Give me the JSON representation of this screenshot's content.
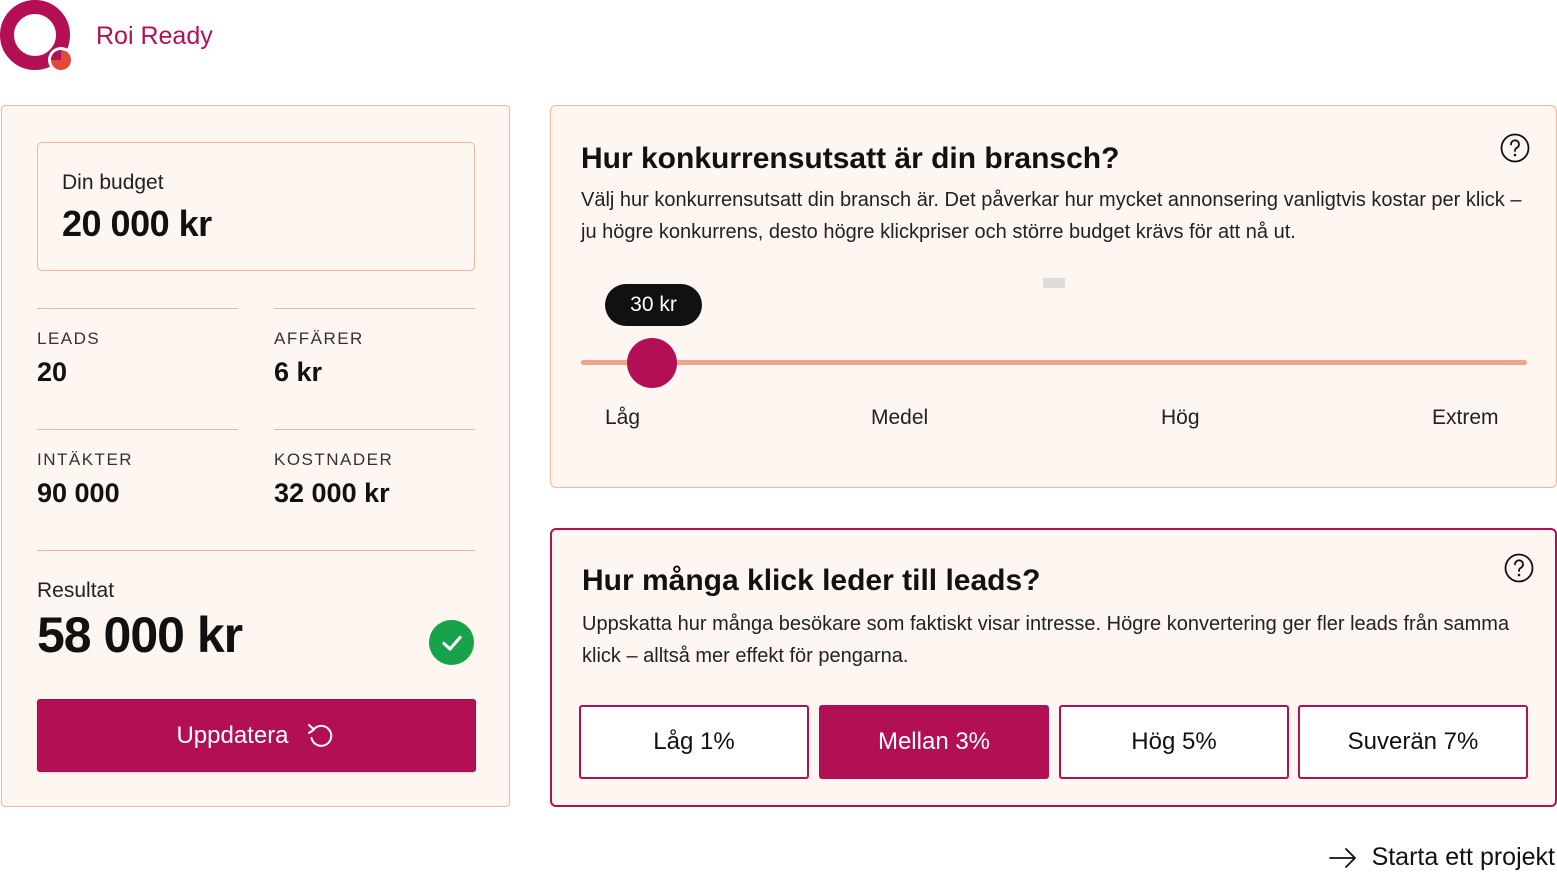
{
  "brand": {
    "name": "Roi Ready",
    "logo_icon": "ring-logo-icon",
    "colors": {
      "primary": "#b30f55",
      "accent": "#e04a3a"
    }
  },
  "summary": {
    "budget_label": "Din budget",
    "budget_value": "20 000 kr",
    "stats": [
      {
        "label": "LEADS",
        "value": "20"
      },
      {
        "label": "AFFÄRER",
        "value": "6 kr"
      },
      {
        "label": "INTÄKTER",
        "value": "90 000"
      },
      {
        "label": "KOSTNADER",
        "value": "32 000 kr"
      }
    ],
    "result_label": "Resultat",
    "result_value": "58 000 kr",
    "result_status_icon": "check-circle-icon",
    "update_button": "Uppdatera",
    "update_icon": "refresh-icon"
  },
  "competition": {
    "title": "Hur konkurrensutsatt är din bransch?",
    "description": "Välj hur konkurrensutsatt din bransch är. Det påverkar hur mycket annonsering vanligtvis kostar per klick – ju högre konkurrens, desto högre klickpriser och större budget krävs för att nå ut.",
    "slider_value_label": "30 kr",
    "slider_fraction": 0.075,
    "scale_labels": [
      "Låg",
      "Medel",
      "Hög",
      "Extrem"
    ],
    "help_icon": "help-circle-icon"
  },
  "conversion": {
    "title": "Hur många klick leder till leads?",
    "description": "Uppskatta hur många besökare som faktiskt visar intresse. Högre konvertering ger fler leads från samma klick – alltså mer effekt för pengarna.",
    "options": [
      "Låg 1%",
      "Mellan 3%",
      "Hög 5%",
      "Suverän 7%"
    ],
    "selected_option": "Mellan 3%",
    "help_icon": "help-circle-icon"
  },
  "footer": {
    "link_label": "Starta ett projekt",
    "link_icon": "arrow-right-icon"
  }
}
